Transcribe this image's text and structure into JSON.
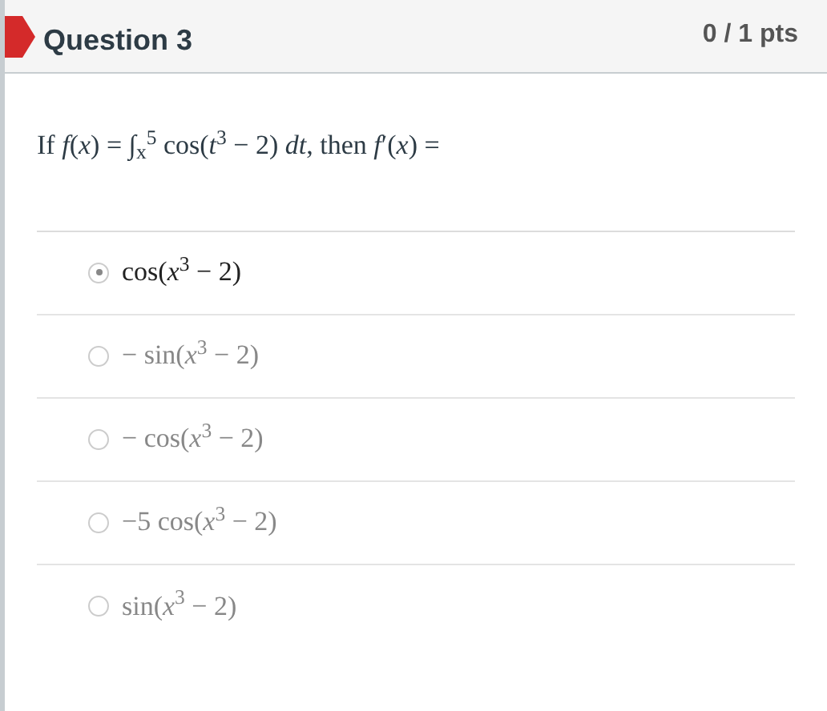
{
  "header": {
    "title": "Question 3",
    "points": "0 / 1 pts"
  },
  "question": "If *f*(*x*) = ∫$_{x}$$^{5}$ cos(*t*$^{3}$ − 2) *dt*, then *f*′(*x*) =",
  "answers": [
    {
      "text": "cos(*x*$^{3}$ − 2)",
      "selected": true
    },
    {
      "text": "− sin(*x*$^{3}$ − 2)",
      "selected": false
    },
    {
      "text": "− cos(*x*$^{3}$ − 2)",
      "selected": false
    },
    {
      "text": "−5 cos(*x*$^{3}$ − 2)",
      "selected": false
    },
    {
      "text": "sin(*x*$^{3}$ − 2)",
      "selected": false
    }
  ]
}
